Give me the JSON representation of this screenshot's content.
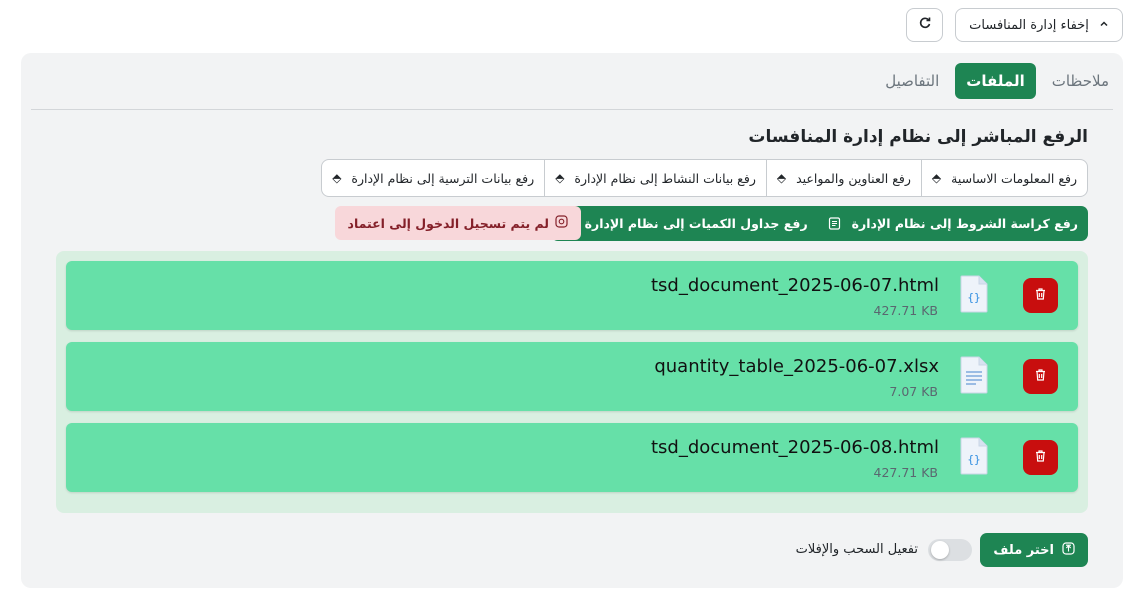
{
  "header": {
    "toggle_label": "إخفاء إدارة المنافسات",
    "refresh_icon": "refresh-icon",
    "chevron_icon": "chevron-up-icon"
  },
  "tabs": [
    {
      "label": "التفاصيل",
      "active": false
    },
    {
      "label": "الملفات",
      "active": true
    },
    {
      "label": "ملاحظات",
      "active": false
    }
  ],
  "section": {
    "title": "الرفع المباشر إلى نظام إدارة المنافسات"
  },
  "upload_buttons": [
    "رفع المعلومات الاساسية",
    "رفع العناوين والمواعيد",
    "رفع بيانات النشاط إلى نظام الإدارة",
    "رفع بيانات الترسية إلى نظام الإدارة"
  ],
  "green_buttons": [
    "رفع كراسة الشروط إلى نظام الإدارة",
    "رفع جداول الكميات إلى نظام الإدارة"
  ],
  "alert": {
    "text": "لم يتم تسجيل الدخول إلى اعتماد"
  },
  "files": [
    {
      "name": "tsd_document_2025-06-07.html",
      "size": "427.71 KB",
      "icon": "code-file-icon"
    },
    {
      "name": "quantity_table_2025-06-07.xlsx",
      "size": "7.07 KB",
      "icon": "text-file-icon"
    },
    {
      "name": "tsd_document_2025-06-08.html",
      "size": "427.71 KB",
      "icon": "code-file-icon"
    }
  ],
  "footer": {
    "choose_file_label": "اختر ملف",
    "dragdrop_label": "تفعيل السحب والإفلات",
    "dragdrop_enabled": false
  },
  "colors": {
    "primary_green": "#1e8553",
    "file_card": "#66e0a8",
    "files_area": "#d9efe1",
    "delete_red": "#c80e0e",
    "alert_bg": "#f8d7da",
    "alert_text": "#842029"
  }
}
